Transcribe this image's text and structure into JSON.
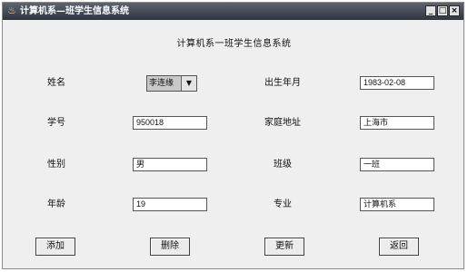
{
  "window": {
    "title": "计算机系—班学生信息系统",
    "app_icon": "java-cup-icon",
    "controls": [
      "_",
      "□",
      "×"
    ]
  },
  "heading": "计算机系一班学生信息系统",
  "form": {
    "name_label": "姓名",
    "name_selected": "李连缘",
    "birth_label": "出生年月",
    "birth_value": "1983-02-08",
    "id_label": "学号",
    "id_value": "950018",
    "address_label": "家庭地址",
    "address_value": "上海市",
    "gender_label": "性别",
    "gender_value": "男",
    "class_label": "班级",
    "class_value": "一班",
    "age_label": "年龄",
    "age_value": "19",
    "major_label": "专业",
    "major_value": "计算机系"
  },
  "buttons": {
    "add": "添加",
    "delete": "删除",
    "update": "更新",
    "back": "返回"
  }
}
